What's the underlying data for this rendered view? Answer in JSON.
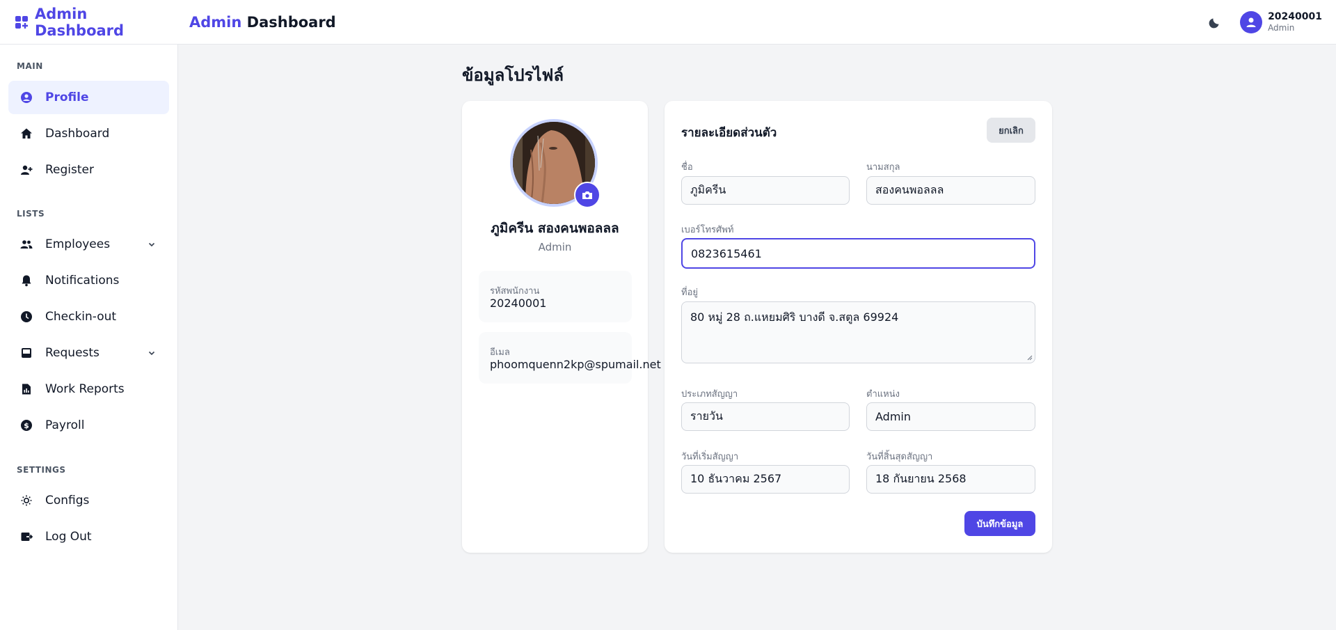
{
  "header": {
    "brand": "Admin Dashboard",
    "heading_accent": "Admin",
    "heading_rest": "Dashboard",
    "user_id": "20240001",
    "user_role": "Admin"
  },
  "sidebar": {
    "sections": {
      "main": "MAIN",
      "lists": "LISTS",
      "settings": "SETTINGS"
    },
    "items": [
      {
        "label": "Profile",
        "icon": "user-circle-icon",
        "active": true
      },
      {
        "label": "Dashboard",
        "icon": "home-icon"
      },
      {
        "label": "Register",
        "icon": "user-plus-icon"
      },
      {
        "label": "Employees",
        "icon": "users-icon",
        "expandable": true
      },
      {
        "label": "Notifications",
        "icon": "bell-icon"
      },
      {
        "label": "Checkin-out",
        "icon": "clock-icon"
      },
      {
        "label": "Requests",
        "icon": "inbox-icon",
        "expandable": true
      },
      {
        "label": "Work Reports",
        "icon": "report-icon"
      },
      {
        "label": "Payroll",
        "icon": "dollar-icon"
      },
      {
        "label": "Configs",
        "icon": "sun-gear-icon"
      },
      {
        "label": "Log Out",
        "icon": "logout-icon"
      }
    ]
  },
  "main": {
    "title": "ข้อมูลโปรไฟล์",
    "profile": {
      "name": "ภูมิครีน สองคนพอลลล",
      "role": "Admin",
      "employee_id_label": "รหัสพนักงาน",
      "employee_id": "20240001",
      "email_label": "อีเมล",
      "email": "phoomquenn2kp@spumail.net"
    },
    "form": {
      "title": "รายละเอียดส่วนตัว",
      "cancel_label": "ยกเลิก",
      "first_name_label": "ชื่อ",
      "first_name": "ภูมิครีน",
      "last_name_label": "นามสกุล",
      "last_name": "สองคนพอลลล",
      "phone_label": "เบอร์โทรศัพท์",
      "phone": "0823615461",
      "address_label": "ที่อยู่",
      "address": "80 หมู่ 28 ถ.แหยมศิริ บางดี จ.สตูล 69924",
      "contract_type_label": "ประเภทสัญญา",
      "contract_type": "รายวัน",
      "position_label": "ตำแหน่ง",
      "position": "Admin",
      "start_date_label": "วันที่เริ่มสัญญา",
      "start_date": "10 ธันวาคม 2567",
      "end_date_label": "วันที่สิ้นสุดสัญญา",
      "end_date": "18 กันยายน 2568",
      "save_label": "บันทึกข้อมูล"
    }
  },
  "colors": {
    "accent": "#4f46e5",
    "active_bg": "#eef2ff",
    "page_bg": "#f3f4f6"
  }
}
